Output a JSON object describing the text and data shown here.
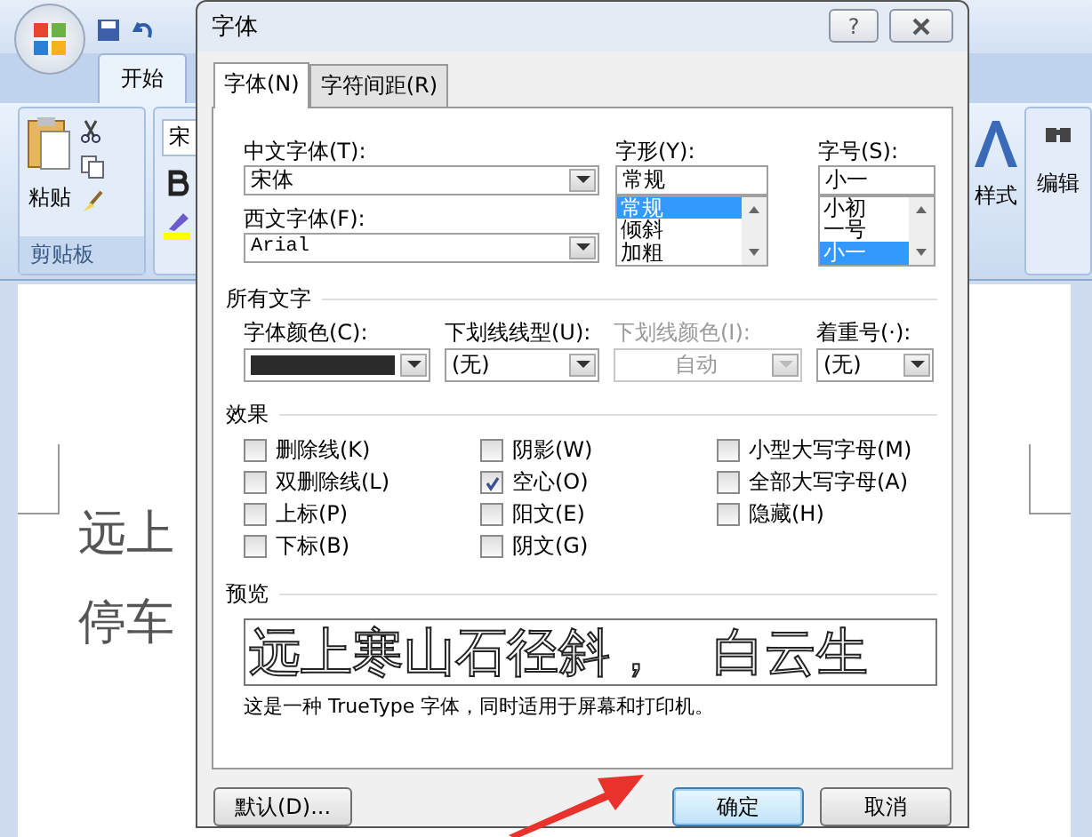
{
  "word": {
    "home_tab": "开始",
    "paste": "粘贴",
    "clipboard_group": "剪贴板",
    "font_box": "宋",
    "styles": "样式",
    "editing": "编辑",
    "document_lines": [
      "远上",
      "停车"
    ]
  },
  "dialog": {
    "title": "字体",
    "help_button": "?",
    "tabs": [
      {
        "label": "字体(N)",
        "selected": true
      },
      {
        "label": "字符间距(R)",
        "selected": false
      }
    ],
    "chinese_font": {
      "label": "中文字体(T):",
      "value": "宋体"
    },
    "western_font": {
      "label": "西文字体(F):",
      "value": "Arial"
    },
    "style": {
      "label": "字形(Y):",
      "value": "常规",
      "options": [
        {
          "text": "常规",
          "selected": true
        },
        {
          "text": "倾斜",
          "selected": false
        },
        {
          "text": "加粗",
          "selected": false
        }
      ]
    },
    "size": {
      "label": "字号(S):",
      "value": "小一",
      "options": [
        {
          "text": "小初",
          "selected": false
        },
        {
          "text": "一号",
          "selected": false
        },
        {
          "text": "小一",
          "selected": true
        }
      ]
    },
    "all_text": {
      "heading": "所有文字",
      "fields": [
        {
          "kind": "color",
          "label": "字体颜色(C):",
          "color": "#2b2b2b",
          "disabled": false
        },
        {
          "kind": "dropdown",
          "label": "下划线线型(U):",
          "value": "(无)",
          "disabled": false
        },
        {
          "kind": "dropdown",
          "label": "下划线颜色(I):",
          "value": "自动",
          "disabled": true
        },
        {
          "kind": "dropdown",
          "label": "着重号(·):",
          "value": "(无)",
          "disabled": false
        }
      ]
    },
    "effects": {
      "heading": "效果",
      "columns": [
        {
          "items": [
            {
              "label": "删除线(K)",
              "checked": false
            },
            {
              "label": "双删除线(L)",
              "checked": false
            },
            {
              "label": "上标(P)",
              "checked": false
            },
            {
              "label": "下标(B)",
              "checked": false
            }
          ]
        },
        {
          "items": [
            {
              "label": "阴影(W)",
              "checked": false
            },
            {
              "label": "空心(O)",
              "checked": true,
              "kind": "outline"
            },
            {
              "label": "阳文(E)",
              "checked": false
            },
            {
              "label": "阴文(G)",
              "checked": false
            }
          ]
        },
        {
          "items": [
            {
              "label": "小型大写字母(M)",
              "checked": false
            },
            {
              "label": "全部大写字母(A)",
              "checked": false
            },
            {
              "label": "隐藏(H)",
              "checked": false
            }
          ]
        }
      ]
    },
    "preview": {
      "heading": "预览",
      "sample": "远上寒山石径斜，　白云生",
      "note": "这是一种 TrueType 字体，同时适用于屏幕和打印机。"
    },
    "buttons": [
      {
        "label": "默认(D)...",
        "kind": "default",
        "focused": false
      },
      {
        "label": "确定",
        "kind": "ok",
        "focused": true
      },
      {
        "label": "取消",
        "kind": "cancel",
        "focused": false
      }
    ]
  }
}
